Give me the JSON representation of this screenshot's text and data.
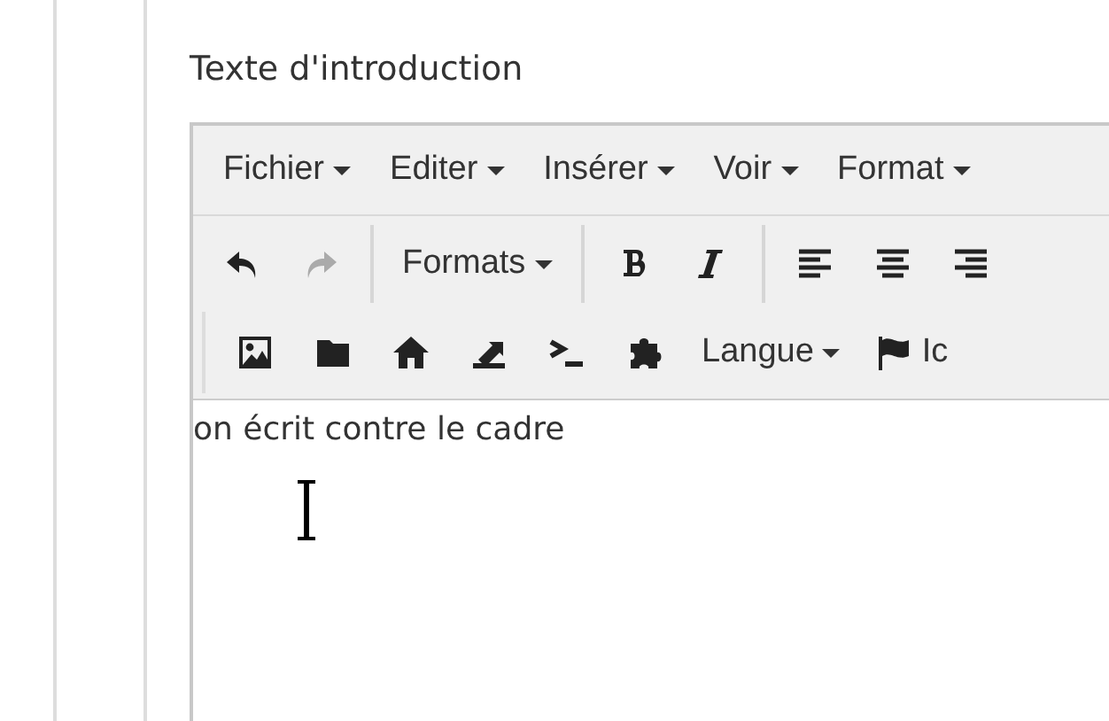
{
  "field_label": "Texte d'introduction",
  "menu": [
    {
      "label": "Fichier"
    },
    {
      "label": "Editer"
    },
    {
      "label": "Insérer"
    },
    {
      "label": "Voir"
    },
    {
      "label": "Format"
    }
  ],
  "toolbar_row_1": [
    {
      "kind": "undo",
      "disabled": false
    },
    {
      "kind": "redo",
      "disabled": true
    },
    {
      "kind": "sep"
    },
    {
      "kind": "dropdown",
      "label": "Formats"
    },
    {
      "kind": "sep"
    },
    {
      "kind": "bold",
      "disabled": false
    },
    {
      "kind": "italic",
      "disabled": false
    },
    {
      "kind": "sep"
    },
    {
      "kind": "alignleft",
      "disabled": false
    },
    {
      "kind": "aligncenter",
      "disabled": false
    },
    {
      "kind": "alignright",
      "disabled": false
    }
  ],
  "toolbar_row_2": [
    {
      "kind": "image",
      "disabled": false
    },
    {
      "kind": "folder",
      "disabled": false
    },
    {
      "kind": "home",
      "disabled": false
    },
    {
      "kind": "export",
      "disabled": false
    },
    {
      "kind": "terminal",
      "disabled": false
    },
    {
      "kind": "puzzle",
      "disabled": false
    },
    {
      "kind": "dropdown",
      "label": "Langue"
    },
    {
      "kind": "flag",
      "label": "Ic"
    }
  ],
  "content": "on écrit contre le cadre"
}
